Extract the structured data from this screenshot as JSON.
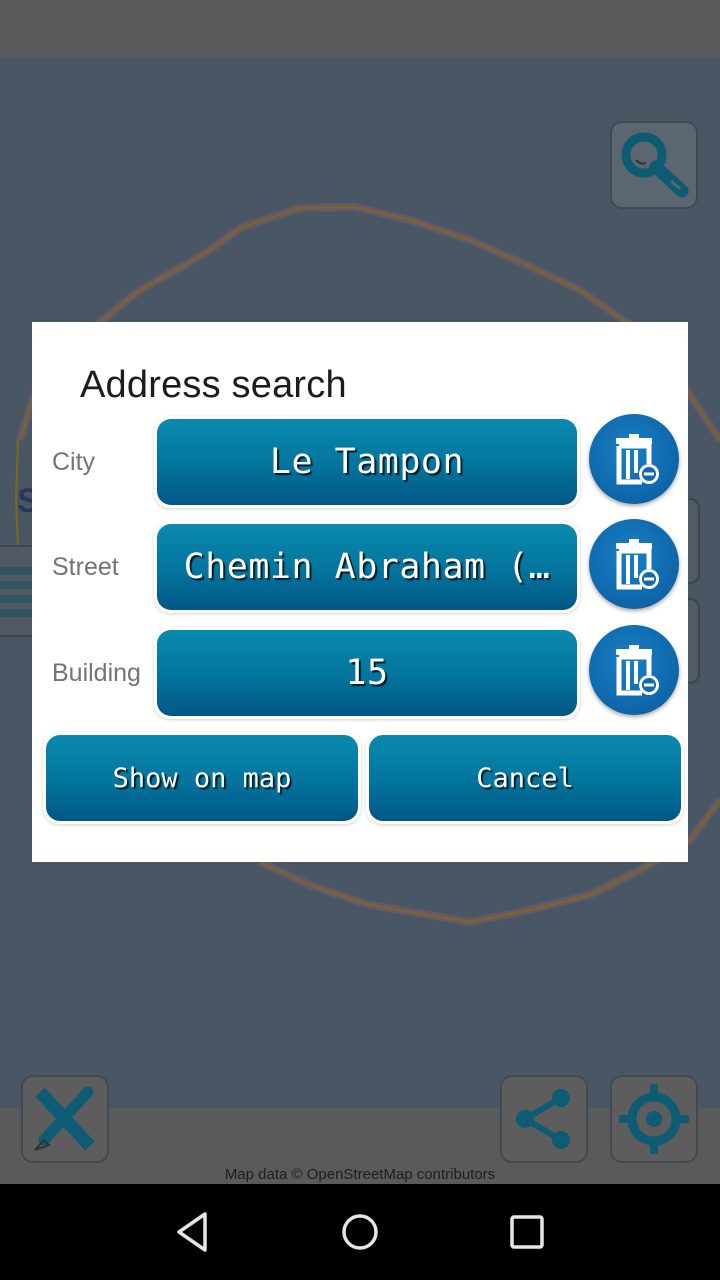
{
  "map": {
    "attribution": "Map data © OpenStreetMap contributors",
    "partial_label_letter": "S",
    "buttons": [
      {
        "name": "search",
        "icon": "magnifier-icon"
      },
      {
        "name": "measure",
        "icon": "ruler-pencil-icon"
      },
      {
        "name": "share",
        "icon": "share-icon"
      },
      {
        "name": "my-location",
        "icon": "crosshair-icon"
      }
    ],
    "colors": {
      "icon_teal": "#0d5c73",
      "overlay_bg": "#495765"
    }
  },
  "dialog": {
    "title": "Address search",
    "fields": [
      {
        "label": "City",
        "value": "Le Tampon",
        "clear_icon": "trash-minus-icon"
      },
      {
        "label": "Street",
        "value": "Chemin Abraham (…",
        "clear_icon": "trash-minus-icon"
      },
      {
        "label": "Building",
        "value": "15",
        "clear_icon": "trash-minus-icon"
      }
    ],
    "show_on_map_label": "Show on map",
    "cancel_label": "Cancel",
    "colors": {
      "button_top": "#0a8aae",
      "button_bottom": "#005785",
      "clear_button": "#0f69ad"
    }
  },
  "nav_bar": {
    "back": "back-icon",
    "home": "home-icon",
    "recents": "recents-icon"
  }
}
